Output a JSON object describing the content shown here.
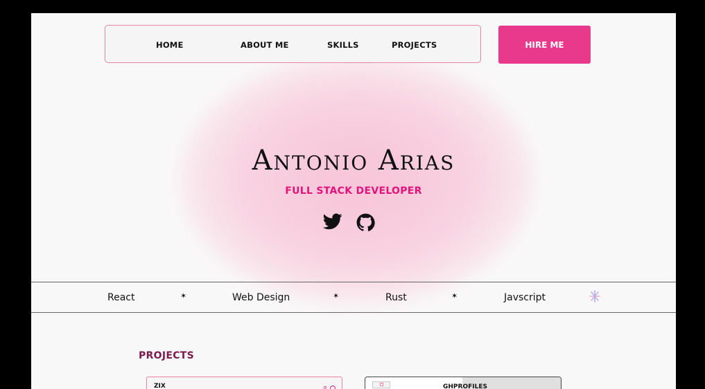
{
  "nav": {
    "items": [
      "HOME",
      "ABOUT ME",
      "SKILLS",
      "PROJECTS"
    ],
    "hire_label": "HIRE ME"
  },
  "hero": {
    "name": "Antonio Arias",
    "role": "FULL STACK DEVELOPER",
    "icons": [
      "twitter-icon",
      "github-icon"
    ]
  },
  "skills_band": {
    "items": [
      "React",
      "Web Design",
      "Rust",
      "Javscript"
    ]
  },
  "projects": {
    "heading": "PROJECTS",
    "cards": [
      {
        "title": "ZIX",
        "icons": [
          "link-icon",
          "github-icon"
        ]
      },
      {
        "title": "GHPROFILES"
      }
    ]
  },
  "colors": {
    "accent": "#e8398c",
    "role_text": "#e2137b",
    "heading": "#7b1a4b",
    "nav_border": "#e8849f",
    "glow": "#f8c8da"
  }
}
